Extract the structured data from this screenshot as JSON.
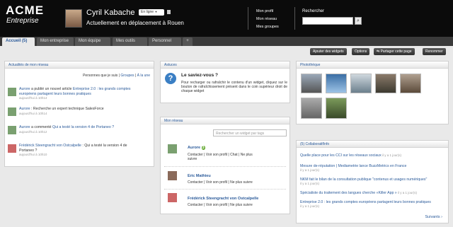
{
  "brand": {
    "name": "ACME",
    "sub": "Entreprise"
  },
  "user": {
    "name": "Cyril Kabache",
    "lang": "En ligne",
    "status": "Actuellement en déplacement à Rouen"
  },
  "toplinks": [
    "Mon profil",
    "Mon réseau",
    "Mes groupes"
  ],
  "search": {
    "label": "Rechercher"
  },
  "tabs": [
    "Accueil (5)",
    "Mon entreprise",
    "Mon équipe",
    "Mes outils",
    "Personnel",
    "+"
  ],
  "toolbar": [
    "Ajouter des widgets",
    "Options",
    "Partager cette page",
    "Renommer"
  ],
  "actus": {
    "title": "Actualités de mon réseau",
    "filter": {
      "prefix": "Personnes que je suis",
      "sep1": " | ",
      "groupes": "Groupes",
      "sep2": " | ",
      "une": "À la une"
    },
    "items": [
      {
        "who": "Aurore",
        "mid": " a publié un nouvel article ",
        "link": "Entreprise 2.0 : les grands comptes européens partagent leurs bonnes pratiques",
        "time": "aujourd'hui à 10h14"
      },
      {
        "who": "Aurore",
        "mid": " : Recherche un expert technique SalesForce",
        "link": "",
        "time": "aujourd'hui à 10h14"
      },
      {
        "who": "Aurore",
        "mid": " a commenté ",
        "link": "Qui a testé la version 4 de Portaneo ?",
        "time": "aujourd'hui à 10h12"
      },
      {
        "who": "Frédérick Steengracht von Ostcalpelle",
        "mid": " : Qui a testé la version 4 de Portaneo ?",
        "link": "",
        "time": "aujourd'hui à 10h10"
      }
    ]
  },
  "astuces": {
    "title": "Astuces",
    "heading": "Le saviez-vous ?",
    "body": "Pour recharger ou rafraîchir le contenu d'un widget, cliquez sur le bouton de rafraîchissement présent dans le coin supérieur droit de chaque widget"
  },
  "reseau": {
    "title": "Mon réseau",
    "placeholder": "Rechercher un widget par tags",
    "contacts": [
      {
        "name": "Aurore",
        "badge": "3",
        "line1": "Contacter | Voir son profil | Chat | Ne plus",
        "line2": "suivre"
      },
      {
        "name": "Eric Mathieu",
        "line1": "Contacter | Voir son profil | Ne plus suivre",
        "line2": ""
      },
      {
        "name": "Frédérick Steengracht von Ostcalpelle",
        "line1": "Contacter | Voir son profil | Ne plus suivre",
        "line2": ""
      }
    ]
  },
  "photo": {
    "title": "Photothèque"
  },
  "collab": {
    "title": "(5) CollaboratifInfo",
    "items": [
      {
        "text": "Quelle place pour les CCI sur les réseaux sociaux",
        "meta": " il y a 1 jour(s)"
      },
      {
        "text": "Mesure de-réputation | Mediametrie lance BuzzMetrics en France",
        "meta": "il y a 1 jour(s)"
      },
      {
        "text": "NKM fait le bilan de la consultation publique \"contenus et usages numériques\"",
        "meta": "il y a 1 jour(s)"
      },
      {
        "text": "Spécialiste du traitement des langues cherche «Killer App »",
        "meta": " il y a 1 jour(s)"
      },
      {
        "text": "Entreprise 2.0 : les grands comptes européens partagent leurs bonnes pratiques",
        "meta": "il y a 1 jour(s)"
      }
    ],
    "next": "Suivants"
  },
  "colors": {
    "topbar": "#0b0b0b",
    "link": "#2a5a9a",
    "bg": "#e9e9e9"
  }
}
